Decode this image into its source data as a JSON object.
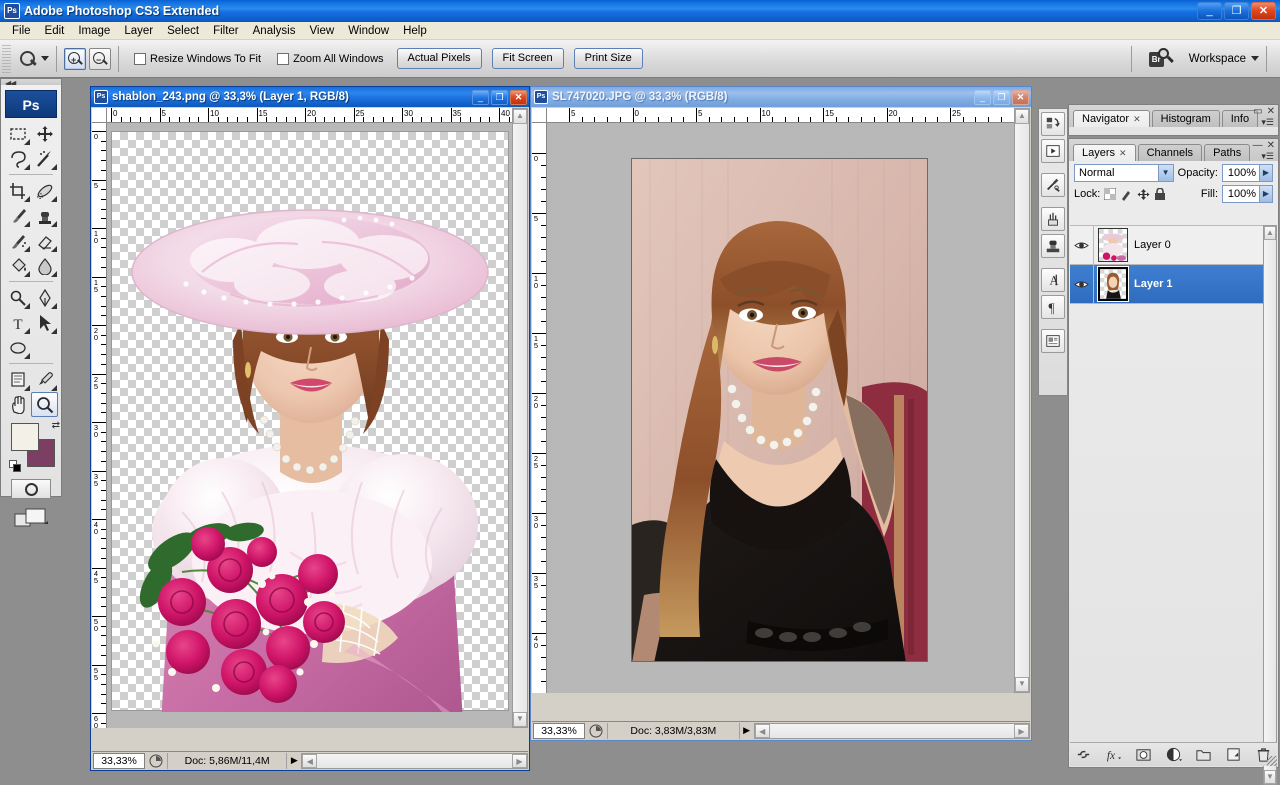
{
  "app": {
    "title": "Adobe Photoshop CS3 Extended",
    "icon": "Ps",
    "window_buttons": {
      "minimize": "_",
      "restore": "❐",
      "close": "✕"
    }
  },
  "menu": {
    "items": [
      "File",
      "Edit",
      "Image",
      "Layer",
      "Select",
      "Filter",
      "Analysis",
      "View",
      "Window",
      "Help"
    ]
  },
  "options_bar": {
    "active_tool_icon": "zoom-tool-icon",
    "zoom_in_icon": "zoom-in-icon",
    "zoom_out_icon": "zoom-out-icon",
    "checkboxes": [
      {
        "label": "Resize Windows To Fit",
        "checked": false
      },
      {
        "label": "Zoom All Windows",
        "checked": false
      }
    ],
    "buttons": [
      "Actual Pixels",
      "Fit Screen",
      "Print Size"
    ],
    "bridge_icon": "Br",
    "workspace_label": "Workspace"
  },
  "toolbox": {
    "badge": "Ps",
    "tools": [
      {
        "name": "marquee-tool",
        "glyph": "rect-marquee",
        "has_flyout": true
      },
      {
        "name": "move-tool",
        "glyph": "move",
        "has_flyout": false
      },
      {
        "name": "lasso-tool",
        "glyph": "lasso",
        "has_flyout": true
      },
      {
        "name": "magic-wand-tool",
        "glyph": "wand",
        "has_flyout": true
      },
      {
        "name": "crop-tool",
        "glyph": "crop",
        "has_flyout": true
      },
      {
        "name": "healing-brush-tool",
        "glyph": "healing",
        "has_flyout": true
      },
      {
        "name": "brush-tool",
        "glyph": "brush",
        "has_flyout": true
      },
      {
        "name": "clone-stamp-tool",
        "glyph": "stamp",
        "has_flyout": true
      },
      {
        "name": "history-brush-tool",
        "glyph": "history-brush",
        "has_flyout": true
      },
      {
        "name": "eraser-tool",
        "glyph": "eraser",
        "has_flyout": true
      },
      {
        "name": "gradient-tool",
        "glyph": "paint-bucket",
        "has_flyout": true
      },
      {
        "name": "blur-tool",
        "glyph": "blur",
        "has_flyout": true
      },
      {
        "name": "dodge-tool",
        "glyph": "dodge",
        "has_flyout": true
      },
      {
        "name": "pen-tool",
        "glyph": "pen",
        "has_flyout": true
      },
      {
        "name": "type-tool",
        "glyph": "T",
        "has_flyout": true
      },
      {
        "name": "path-selection-tool",
        "glyph": "arrow",
        "has_flyout": true
      },
      {
        "name": "ellipse-shape-tool",
        "glyph": "ellipse",
        "has_flyout": true
      },
      {
        "name": "notes-tool",
        "glyph": "notes",
        "has_flyout": true
      },
      {
        "name": "eyedropper-tool",
        "glyph": "eyedropper",
        "has_flyout": true
      },
      {
        "name": "hand-tool",
        "glyph": "hand",
        "has_flyout": false
      },
      {
        "name": "zoom-tool",
        "glyph": "zoom",
        "has_flyout": false,
        "selected": true
      }
    ],
    "foreground_color": "#f3f1e7",
    "background_color": "#7c3e63",
    "quick_mask_icon": "quick-mask-icon",
    "screen_mode_icon": "screen-mode-icon"
  },
  "documents": [
    {
      "title": "shablon_243.png @ 33,3% (Layer 1, RGB/8)",
      "active": true,
      "zoom": "33,33%",
      "doc_size": "Doc: 5,86M/11,4M",
      "ruler_h_labels": [
        "0",
        "5",
        "10",
        "15",
        "20",
        "25",
        "30",
        "35",
        "40"
      ],
      "ruler_v_labels": [
        "0",
        "5",
        "10",
        "15",
        "20",
        "25",
        "30",
        "35",
        "40",
        "45",
        "50",
        "55",
        "60"
      ],
      "buttons": {
        "minimize": "_",
        "maximize": "❐",
        "close": "✕"
      }
    },
    {
      "title": "SL747020.JPG @ 33,3% (RGB/8)",
      "active": false,
      "zoom": "33,33%",
      "doc_size": "Doc: 3,83M/3,83M",
      "ruler_h_labels": [
        "5",
        "0",
        "5",
        "10",
        "15",
        "20",
        "25"
      ],
      "buttons": {
        "minimize": "_",
        "maximize": "❐",
        "close": "✕"
      }
    }
  ],
  "dock_icons": [
    {
      "name": "history-panel-icon"
    },
    {
      "name": "actions-panel-icon"
    },
    {
      "name": "tool-presets-panel-icon"
    },
    {
      "name": "brushes-panel-icon"
    },
    {
      "name": "clone-source-panel-icon"
    },
    {
      "name": "character-panel-icon"
    },
    {
      "name": "paragraph-panel-icon"
    },
    {
      "name": "layer-comps-panel-icon"
    }
  ],
  "navigator_panel": {
    "tabs": [
      {
        "label": "Navigator",
        "active": true,
        "closable": true
      },
      {
        "label": "Histogram",
        "active": false,
        "closable": false
      },
      {
        "label": "Info",
        "active": false,
        "closable": false
      }
    ],
    "minimize": "▭",
    "close": "✕"
  },
  "layers_panel": {
    "tabs": [
      {
        "label": "Layers",
        "active": true,
        "closable": true
      },
      {
        "label": "Channels",
        "active": false,
        "closable": false
      },
      {
        "label": "Paths",
        "active": false,
        "closable": false
      }
    ],
    "minimize": "—",
    "close": "✕",
    "blend_mode": "Normal",
    "opacity_label": "Opacity:",
    "opacity_value": "100%",
    "lock_label": "Lock:",
    "lock_icons": [
      "lock-transparent-icon",
      "lock-image-icon",
      "lock-position-icon",
      "lock-all-icon"
    ],
    "fill_label": "Fill:",
    "fill_value": "100%",
    "layers": [
      {
        "name": "Layer 0",
        "visible": true,
        "selected": false,
        "thumb": "bride-template-thumb"
      },
      {
        "name": "Layer 1",
        "visible": true,
        "selected": true,
        "thumb": "portrait-thumb"
      }
    ],
    "bottom_buttons": [
      {
        "name": "link-layers-icon",
        "glyph": "⛓"
      },
      {
        "name": "layer-style-icon",
        "glyph": "fx"
      },
      {
        "name": "layer-mask-icon",
        "glyph": "▣"
      },
      {
        "name": "adjustment-layer-icon",
        "glyph": "◐"
      },
      {
        "name": "new-group-icon",
        "glyph": "▭"
      },
      {
        "name": "new-layer-icon",
        "glyph": "⬓"
      },
      {
        "name": "delete-layer-icon",
        "glyph": "🗑"
      }
    ]
  }
}
